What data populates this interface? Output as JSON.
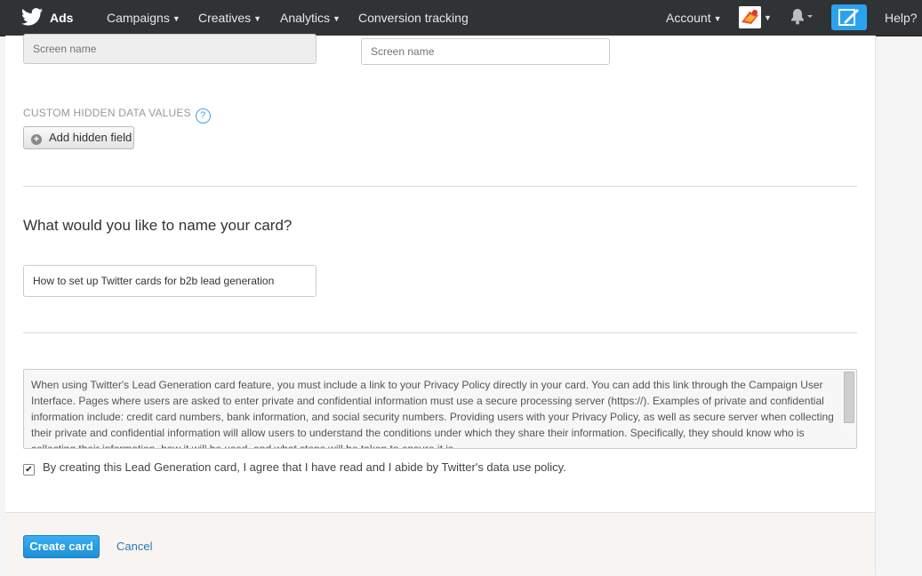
{
  "nav": {
    "brand": "Ads",
    "items": [
      "Campaigns",
      "Creatives",
      "Analytics",
      "Conversion tracking"
    ],
    "account": "Account",
    "help": "Help?"
  },
  "form": {
    "screen_name_left_placeholder": "Screen name",
    "screen_name_right_placeholder": "Screen name",
    "hidden_section_label": "CUSTOM HIDDEN DATA VALUES",
    "help_glyph": "?",
    "add_hidden_field_label": "Add hidden field",
    "card_name_question": "What would you like to name your card?",
    "card_name_value": "How to set up Twitter cards for b2b lead generation",
    "terms_text": "When using Twitter's Lead Generation card feature, you must include a link to your Privacy Policy directly in your card. You can add this link through the Campaign User Interface. Pages where users are asked to enter private and confidential information must use a secure processing server (https://). Examples of private and confidential information include: credit card numbers, bank information, and social security numbers. Providing users with your Privacy Policy, as well as secure server when collecting their private and confidential information will allow users to understand the conditions under which they share their information. Specifically, they should know who is collecting their information, how it will be used, and what steps will be taken to ensure it is",
    "agree_label": "By creating this Lead Generation card, I agree that I have read and I abide by Twitter's data use policy.",
    "agree_checked": true
  },
  "footer": {
    "create_label": "Create card",
    "cancel_label": "Cancel"
  },
  "colors": {
    "nav_bg": "#303336",
    "accent": "#2aa3ef",
    "link": "#2b7bb9"
  }
}
